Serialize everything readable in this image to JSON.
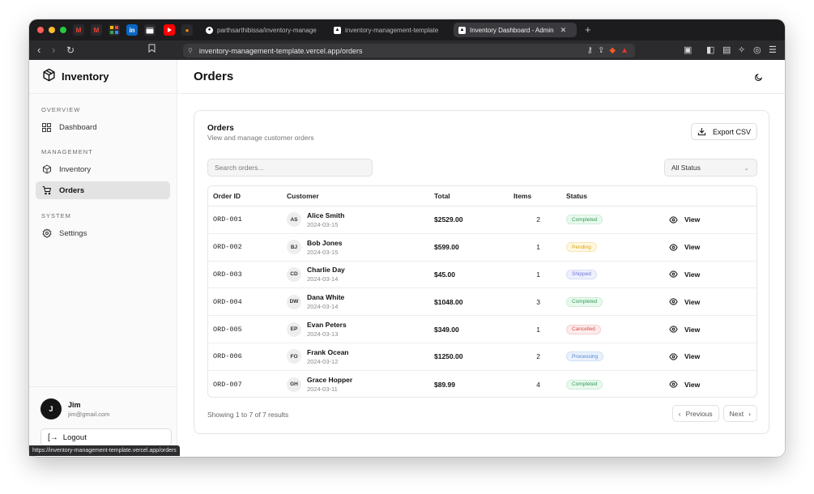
{
  "browser": {
    "tabs": [
      {
        "label": "parthsarthibissa/inventory-manage",
        "icon": "github-icon"
      },
      {
        "label": "inventory-management-template",
        "icon": "vercel-icon"
      },
      {
        "label": "Inventory Dashboard - Admin",
        "icon": "vercel-icon",
        "active": true
      }
    ],
    "pinned": [
      "gmail-icon",
      "gmail-icon",
      "grid-app-icon",
      "linkedin-icon",
      "calendar-icon",
      "youtube-icon",
      "flame-icon"
    ],
    "url": "inventory-management-template.vercel.app/orders",
    "status_url": "https://inventory-management-template.vercel.app/orders"
  },
  "sidebar": {
    "brand": "Inventory",
    "sections": [
      {
        "title": "OVERVIEW",
        "items": [
          {
            "label": "Dashboard",
            "icon": "grid-icon"
          }
        ]
      },
      {
        "title": "MANAGEMENT",
        "items": [
          {
            "label": "Inventory",
            "icon": "box-icon"
          },
          {
            "label": "Orders",
            "icon": "cart-icon",
            "active": true
          }
        ]
      },
      {
        "title": "SYSTEM",
        "items": [
          {
            "label": "Settings",
            "icon": "gear-icon"
          }
        ]
      }
    ],
    "user": {
      "initial": "J",
      "name": "Jim",
      "email": "jim@gmail.com"
    },
    "logout": "Logout"
  },
  "header": {
    "title": "Orders"
  },
  "card": {
    "title": "Orders",
    "subtitle": "View and manage customer orders",
    "export_label": "Export CSV",
    "search_placeholder": "Search orders...",
    "status_filter": "All Status",
    "columns": [
      "Order ID",
      "Customer",
      "Total",
      "Items",
      "Status"
    ],
    "orders": [
      {
        "id": "ORD-001",
        "initials": "AS",
        "name": "Alice Smith",
        "date": "2024-03-15",
        "total": "$2529.00",
        "items": "2",
        "status": "Completed"
      },
      {
        "id": "ORD-002",
        "initials": "BJ",
        "name": "Bob Jones",
        "date": "2024-03-15",
        "total": "$599.00",
        "items": "1",
        "status": "Pending"
      },
      {
        "id": "ORD-003",
        "initials": "CD",
        "name": "Charlie Day",
        "date": "2024-03-14",
        "total": "$45.00",
        "items": "1",
        "status": "Shipped"
      },
      {
        "id": "ORD-004",
        "initials": "DW",
        "name": "Dana White",
        "date": "2024-03-14",
        "total": "$1048.00",
        "items": "3",
        "status": "Completed"
      },
      {
        "id": "ORD-005",
        "initials": "EP",
        "name": "Evan Peters",
        "date": "2024-03-13",
        "total": "$349.00",
        "items": "1",
        "status": "Cancelled"
      },
      {
        "id": "ORD-006",
        "initials": "FO",
        "name": "Frank Ocean",
        "date": "2024-03-12",
        "total": "$1250.00",
        "items": "2",
        "status": "Processing"
      },
      {
        "id": "ORD-007",
        "initials": "GH",
        "name": "Grace Hopper",
        "date": "2024-03-11",
        "total": "$89.99",
        "items": "4",
        "status": "Completed"
      }
    ],
    "view_label": "View",
    "results_text": "Showing 1 to 7 of 7 results",
    "prev_label": "Previous",
    "next_label": "Next"
  },
  "status_colors": {
    "Completed": {
      "bg": "#e9f9ee",
      "fg": "#2f9e55",
      "border": "#cdeed8"
    },
    "Pending": {
      "bg": "#fff8e1",
      "fg": "#d9a216",
      "border": "#f6e6b0"
    },
    "Shipped": {
      "bg": "#eef0fd",
      "fg": "#6b74d6",
      "border": "#d9ddf8"
    },
    "Cancelled": {
      "bg": "#fdecec",
      "fg": "#d44b4b",
      "border": "#f6cfcf"
    },
    "Processing": {
      "bg": "#eaf2fd",
      "fg": "#4f86d6",
      "border": "#cfe0f6"
    }
  }
}
